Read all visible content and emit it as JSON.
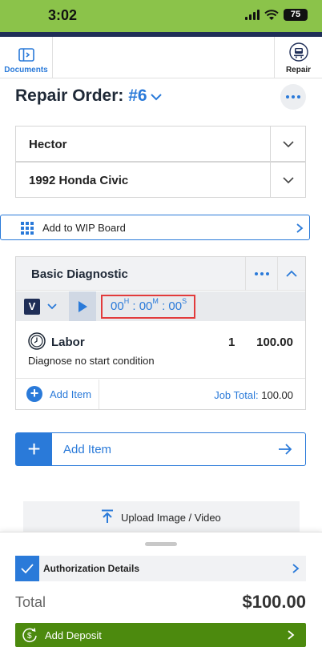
{
  "status_bar": {
    "time": "3:02",
    "battery": "75"
  },
  "tabs": {
    "documents_label": "Documents",
    "repair_label": "Repair"
  },
  "header": {
    "title": "Repair Order:",
    "number": "#6"
  },
  "customer": {
    "name": "Hector"
  },
  "vehicle": {
    "name": "1992 Honda Civic"
  },
  "wip": {
    "label": "Add to WIP Board"
  },
  "job": {
    "title": "Basic Diagnostic",
    "tech_badge": "V",
    "timer": {
      "hours": "00",
      "h_unit": "H",
      "minutes": "00",
      "m_unit": "M",
      "seconds": "00",
      "s_unit": "S"
    },
    "labor": {
      "name": "Labor",
      "qty": "1",
      "amount": "100.00",
      "description": "Diagnose no start condition"
    },
    "add_item_label": "Add Item",
    "total_label": "Job Total:",
    "total_value": "100.00"
  },
  "add_item": {
    "label": "Add Item"
  },
  "upload": {
    "label": "Upload Image / Video"
  },
  "sheet": {
    "auth_label": "Authorization Details",
    "total_label": "Total",
    "total_value": "$100.00",
    "deposit_label": "Add Deposit"
  },
  "colors": {
    "accent": "#2a7ad9",
    "status_bar": "#8bc34a",
    "deposit": "#4c8a0e",
    "navy": "#1f2e57",
    "highlight": "#e23b3b"
  }
}
